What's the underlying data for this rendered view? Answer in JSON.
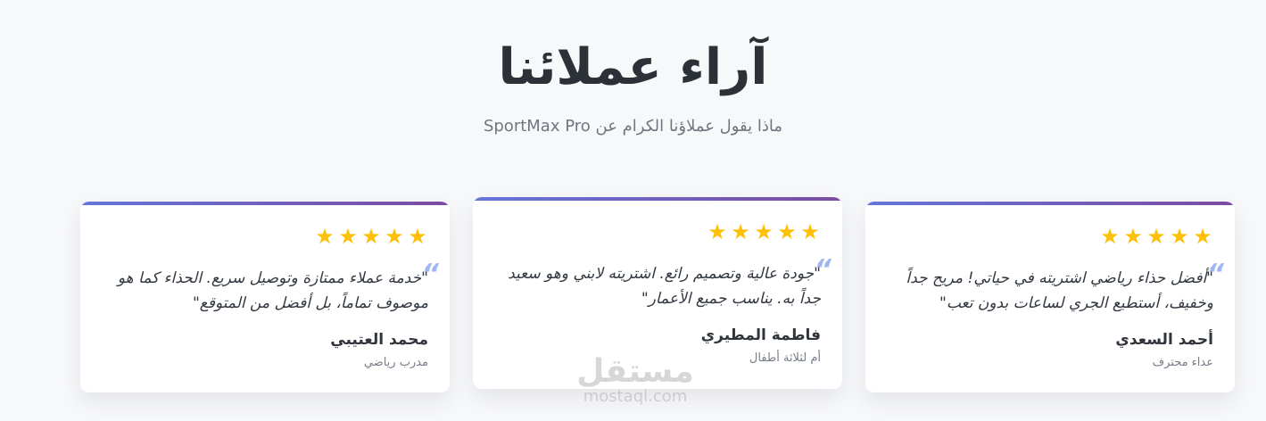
{
  "section": {
    "title": "آراء عملائنا",
    "subtitle": "ماذا يقول عملاؤنا الكرام عن SportMax Pro"
  },
  "testimonials": [
    {
      "rating": 5,
      "text": "\"خدمة عملاء ممتازة وتوصيل سريع. الحذاء كما هو موصوف تماماً، بل أفضل من المتوقع\"",
      "name": "محمد العتيبي",
      "role": "مدرب رياضي"
    },
    {
      "rating": 5,
      "text": "\"جودة عالية وتصميم رائع. اشتريته لابني وهو سعيد جداً به. يناسب جميع الأعمار\"",
      "name": "فاطمة المطيري",
      "role": "أم لثلاثة أطفال"
    },
    {
      "rating": 5,
      "text": "\"أفضل حذاء رياضي اشتريته في حياتي! مريح جداً وخفيف، أستطيع الجري لساعات بدون تعب\"",
      "name": "أحمد السعدي",
      "role": "عداء محترف"
    }
  ],
  "watermark": {
    "main": "مستقل",
    "sub": "mostaql.com"
  },
  "colors": {
    "star": "#ffc107",
    "top_border_start": "#6476da",
    "top_border_end": "#7c4ba2",
    "quote_mark": "#9eb7ef"
  },
  "icons": {
    "star": "star-icon",
    "quote": "quote-icon"
  }
}
